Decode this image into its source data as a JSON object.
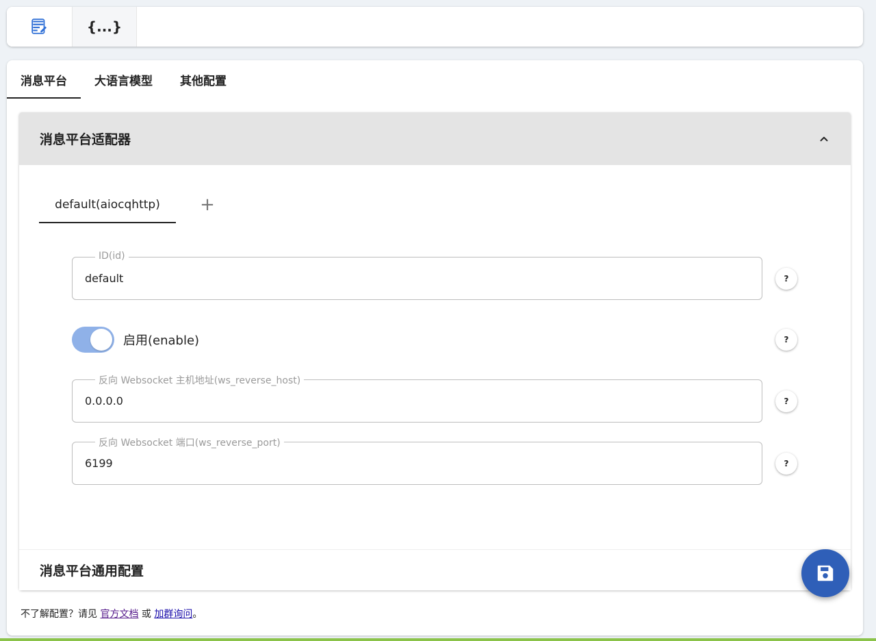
{
  "toolbar": {
    "json_mode_label": "{...}"
  },
  "tabs": [
    {
      "label": "消息平台"
    },
    {
      "label": "大语言模型"
    },
    {
      "label": "其他配置"
    }
  ],
  "adapter_panel": {
    "title": "消息平台适配器",
    "sub_tabs": [
      {
        "label": "default(aiocqhttp)"
      }
    ],
    "add_label": "+",
    "fields": {
      "id": {
        "label": "ID(id)",
        "value": "default"
      },
      "enable": {
        "label": "启用(enable)",
        "checked": true
      },
      "host": {
        "label": "反向 Websocket 主机地址(ws_reverse_host)",
        "value": "0.0.0.0"
      },
      "port": {
        "label": "反向 Websocket 端口(ws_reverse_port)",
        "value": "6199"
      }
    },
    "help_label": "?"
  },
  "general_panel": {
    "title": "消息平台通用配置"
  },
  "footer": {
    "prefix": "不了解配置？请见 ",
    "docs_link": "官方文档",
    "middle": " 或 ",
    "group_link": "加群询问",
    "suffix": "。"
  },
  "colors": {
    "accent": "#2f5fb8",
    "switch_on": "#8fb1e8",
    "panel_header_bg": "#e4e4e4",
    "page_bg": "#eef2f6"
  },
  "icons": {
    "visual_mode": "edit-note-icon",
    "json_mode": "code-braces-icon",
    "collapse": "chevron-up-icon",
    "save": "floppy-disk-icon"
  }
}
